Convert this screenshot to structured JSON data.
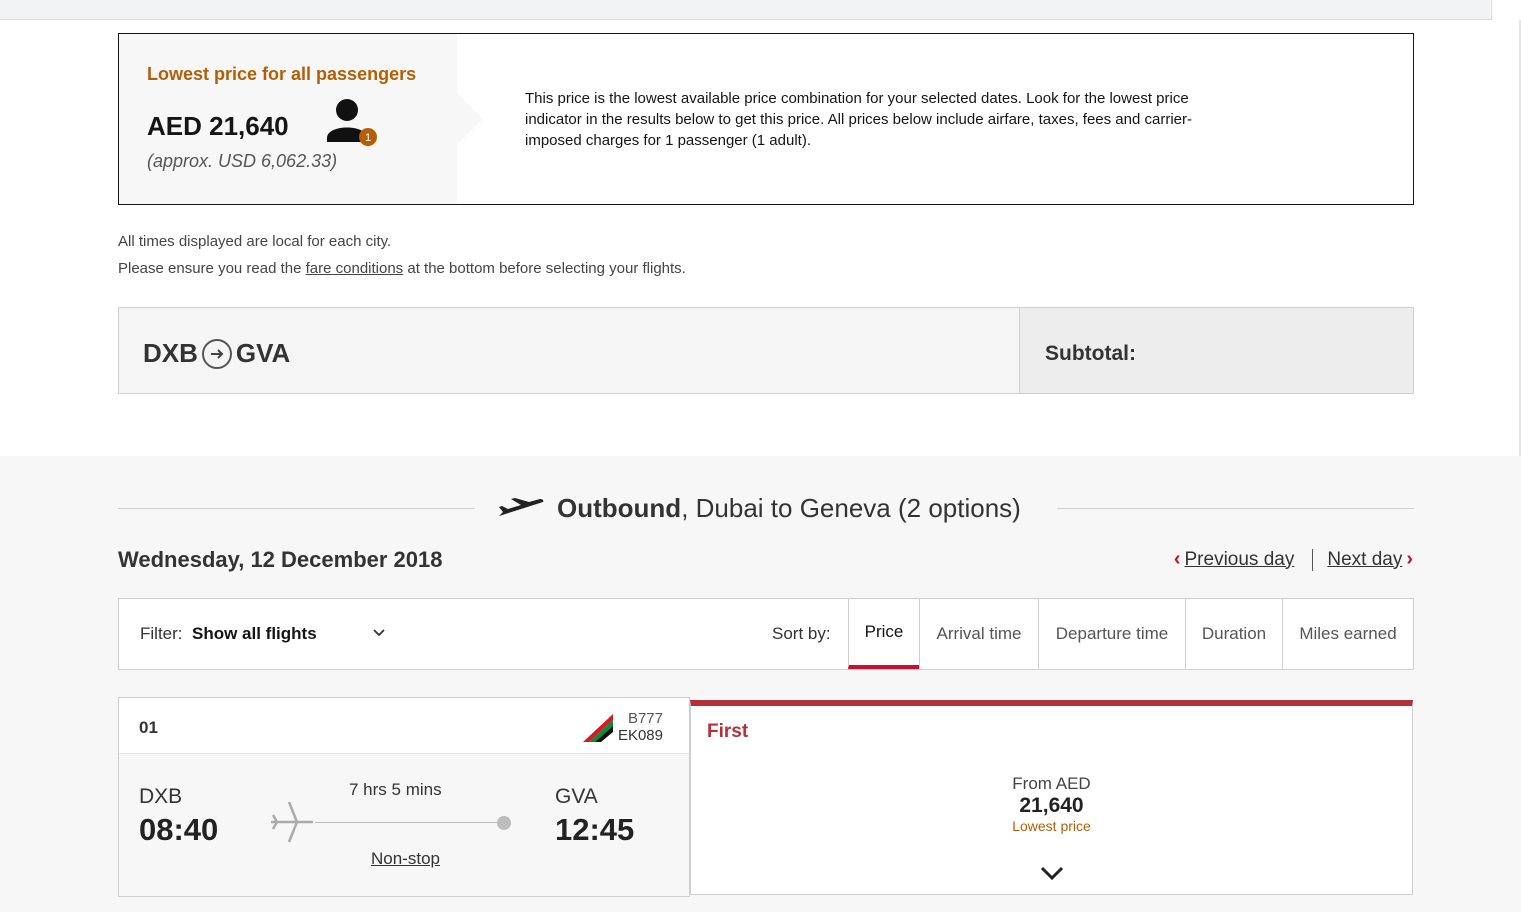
{
  "lowest_price": {
    "heading": "Lowest price for all passengers",
    "amount": "AED 21,640",
    "approx": "(approx. USD 6,062.33)",
    "passenger_count": "1",
    "description": "This price is the lowest available price combination for your selected dates. Look for the lowest price indicator in the results below to get this price. All prices below include airfare, taxes, fees and carrier-imposed charges for 1 passenger (1 adult)."
  },
  "notes": {
    "times_local": "All times displayed are local for each city.",
    "fare_prefix": "Please ensure you read the ",
    "fare_link": "fare conditions",
    "fare_suffix": " at the bottom before selecting your flights."
  },
  "route": {
    "origin": "DXB",
    "destination": "GVA",
    "subtotal_label": "Subtotal:"
  },
  "outbound": {
    "label": "Outbound",
    "rest": ", Dubai to Geneva (2 options)"
  },
  "date_nav": {
    "date": "Wednesday, 12 December 2018",
    "previous": "Previous day",
    "next": "Next day"
  },
  "filter": {
    "label": "Filter:",
    "value": "Show all flights",
    "sort_label": "Sort by:",
    "sort_options": [
      "Price",
      "Arrival time",
      "Departure time",
      "Duration",
      "Miles earned"
    ],
    "active_sort": "Price"
  },
  "flight": {
    "number": "01",
    "aircraft": "B777",
    "flight_no": "EK089",
    "origin_code": "DXB",
    "departure": "08:40",
    "destination_code": "GVA",
    "arrival": "12:45",
    "duration": "7  hrs 5  mins",
    "stops": "Non-stop"
  },
  "fare": {
    "cabin": "First",
    "from_label": "From AED",
    "price": "21,640",
    "lowest_label": "Lowest price"
  },
  "colors": {
    "accent_red": "#c8102e",
    "cabin_red": "#b2313a",
    "lowest_orange": "#b45f06"
  }
}
